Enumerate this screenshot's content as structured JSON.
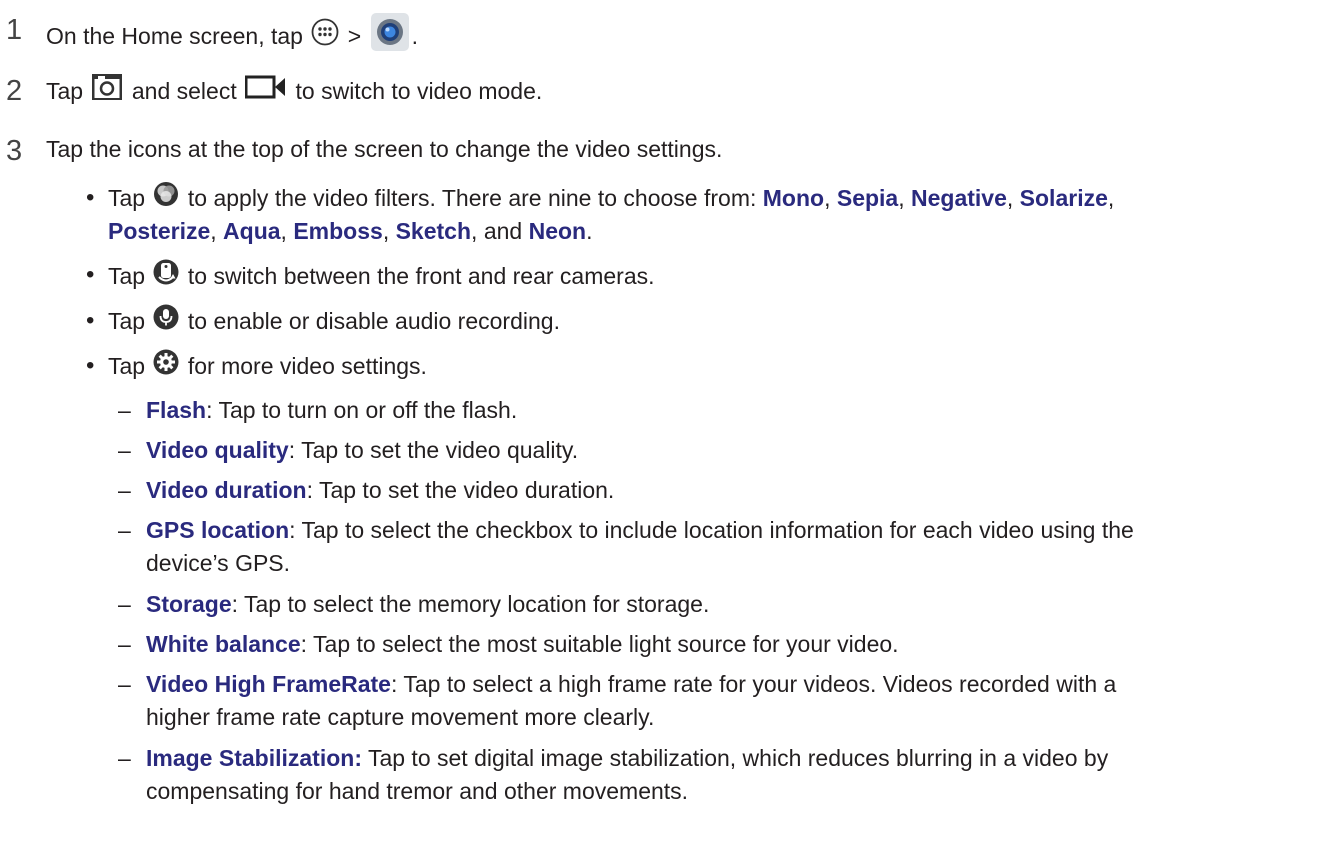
{
  "steps": [
    {
      "num": "1",
      "before": "On the Home screen, tap",
      "between": ">",
      "after": "."
    },
    {
      "num": "2",
      "before": "Tap",
      "middle": "and select",
      "after": "to switch to video mode."
    },
    {
      "num": "3",
      "text": "Tap the icons at the top of the screen to change the video settings."
    }
  ],
  "bullets": {
    "filters": {
      "tap": "Tap",
      "text1": "to apply the video filters. There are nine to choose from:",
      "filters": [
        "Mono",
        "Sepia",
        "Negative",
        "Solarize",
        "Posterize",
        "Aqua",
        "Emboss",
        "Sketch",
        "Neon"
      ],
      "sep": ",",
      "and": "and",
      "end": "."
    },
    "switch_camera": {
      "tap": "Tap",
      "text": "to switch between the front and rear cameras."
    },
    "audio": {
      "tap": "Tap",
      "text": "to enable or disable audio recording."
    },
    "settings": {
      "tap": "Tap",
      "text": "for more video settings."
    }
  },
  "settings_items": [
    {
      "label": "Flash",
      "text": ": Tap to turn on or off the flash."
    },
    {
      "label": "Video quality",
      "text": ": Tap to set the video quality."
    },
    {
      "label": "Video duration",
      "text": ": Tap to set the video duration."
    },
    {
      "label": "GPS location",
      "text": ": Tap to select the checkbox to include location information for each video using the",
      "text2": "device’s GPS."
    },
    {
      "label": "Storage",
      "text": ": Tap to select the memory location for storage."
    },
    {
      "label": "White balance",
      "text": ": Tap to select the most suitable light source for your video."
    },
    {
      "label": "Video High FrameRate",
      "text": ": Tap to select a high frame rate for your videos. Videos recorded with a",
      "text2": "higher frame rate capture movement more clearly."
    },
    {
      "label": "Image Stabilization:",
      "text": " Tap to set digital image stabilization, which reduces blurring in a video by",
      "text2": "compensating for hand tremor and other movements."
    }
  ],
  "symbols": {
    "bullet": "•",
    "dash": "–"
  },
  "colors": {
    "label": "#2a2a7e",
    "text": "#231f20"
  }
}
